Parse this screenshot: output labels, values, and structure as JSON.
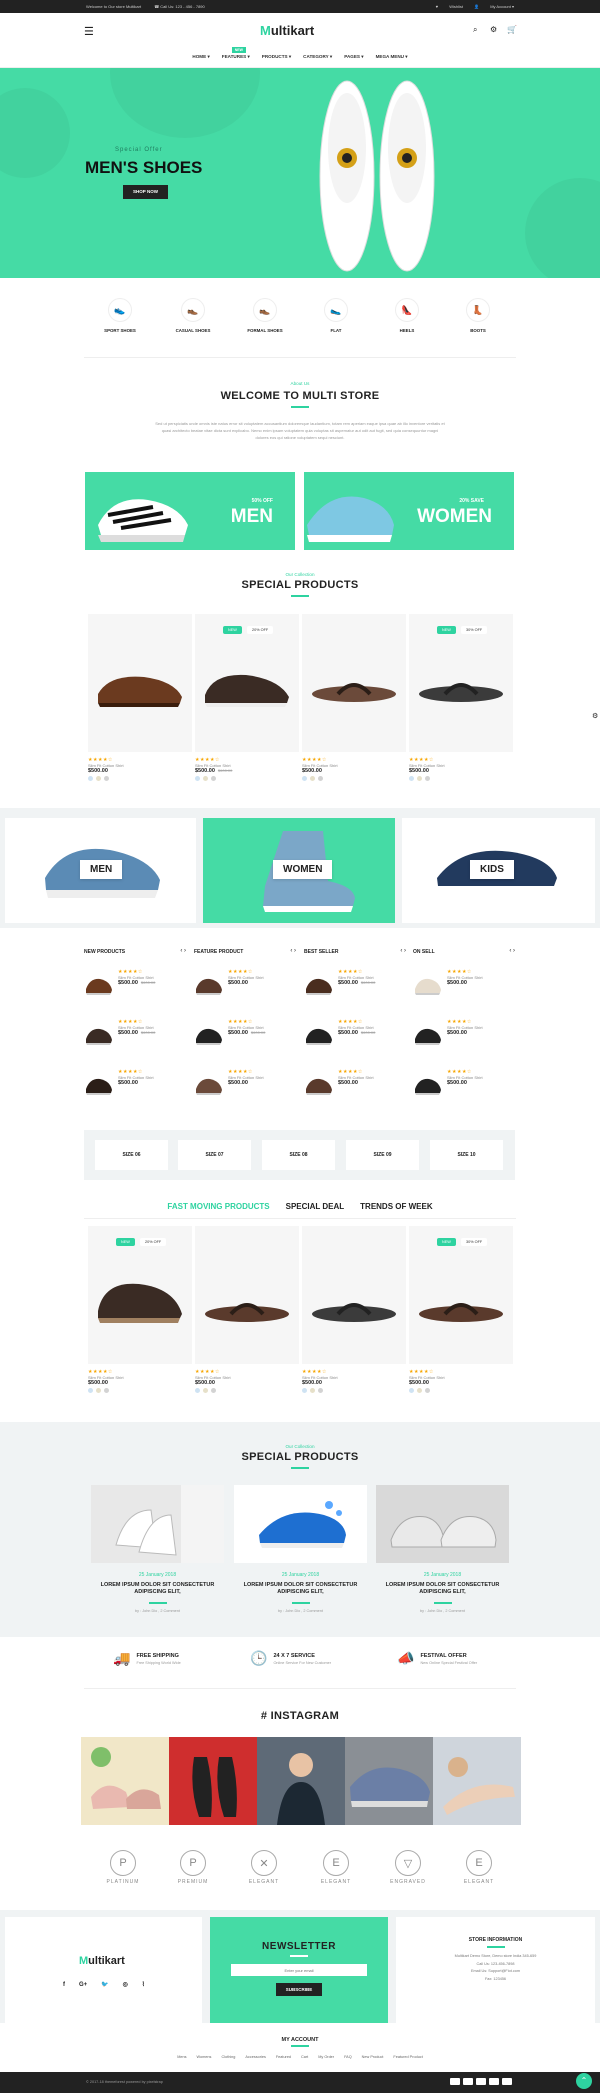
{
  "topbar": {
    "welcome": "Welcome to Our store Multikart",
    "phone": "Call Us: 123 - 456 - 7890",
    "wishlist": "Wishlist",
    "account": "My Account"
  },
  "header": {
    "logo_initial": "M",
    "logo_rest": "ultikart",
    "nav": [
      {
        "label": "HOME"
      },
      {
        "label": "FEATURES",
        "badge": "NEW"
      },
      {
        "label": "PRODUCTS"
      },
      {
        "label": "CATEGORY"
      },
      {
        "label": "PAGES"
      },
      {
        "label": "MEGA MENU"
      }
    ]
  },
  "hero": {
    "kicker": "Special Offer",
    "title": "MEN'S SHOES",
    "button": "SHOP NOW",
    "bg": "#45dba5"
  },
  "categories": [
    "SPORT SHOES",
    "CASUAL SHOES",
    "FORMAL SHOES",
    "FLAT",
    "HEELS",
    "BOOTS"
  ],
  "about": {
    "sub": "About Us",
    "title": "WELCOME TO MULTI STORE",
    "text": "Sed ut perspiciatis unde omnis iste natus error sit voluptatem accusantium doloremque laudantium, totam rem aperiam eaque ipsa quae ab illo inventore veritatis et quasi architecto beatae vitae dicta sunt explicabo. Nemo enim ipsam voluptatem quia voluptas sit aspernatur aut odit aut fugit, sed quia consequuntur magni dolores eos qui ratione voluptatem sequi nesciunt."
  },
  "promo": [
    {
      "off": "50% OFF",
      "label": "MEN"
    },
    {
      "off": "20% SAVE",
      "label": "WOMEN"
    }
  ],
  "special": {
    "sub": "Our Collection",
    "title": "SPECIAL PRODUCTS",
    "products": [
      {
        "name": "Slim Fit Cotton Shirt",
        "price": "$500.00",
        "old": "",
        "new": "",
        "off": ""
      },
      {
        "name": "Slim Fit Cotton Shirt",
        "price": "$500.00",
        "old": "$600.00",
        "new": "NEW",
        "off": "20% OFF"
      },
      {
        "name": "Slim Fit Cotton Shirt",
        "price": "$500.00",
        "old": "",
        "new": "",
        "off": ""
      },
      {
        "name": "Slim Fit Cotton Shirt",
        "price": "$500.00",
        "old": "",
        "new": "NEW",
        "off": "30% OFF"
      }
    ]
  },
  "catbanner": [
    "MEN",
    "WOMEN",
    "KIDS"
  ],
  "lists": [
    {
      "title": "NEW PRODUCTS",
      "items": [
        {
          "name": "Slim Fit Cotton Shirt",
          "price": "$500.00",
          "old": "$600.00"
        },
        {
          "name": "Slim Fit Cotton Shirt",
          "price": "$500.00",
          "old": "$600.00"
        },
        {
          "name": "Slim Fit Cotton Shirt",
          "price": "$500.00",
          "old": ""
        }
      ]
    },
    {
      "title": "FEATURE PRODUCT",
      "items": [
        {
          "name": "Slim Fit Cotton Shirt",
          "price": "$500.00",
          "old": ""
        },
        {
          "name": "Slim Fit Cotton Shirt",
          "price": "$500.00",
          "old": "$600.00"
        },
        {
          "name": "Slim Fit Cotton Shirt",
          "price": "$500.00",
          "old": ""
        }
      ]
    },
    {
      "title": "BEST SELLER",
      "items": [
        {
          "name": "Slim Fit Cotton Shirt",
          "price": "$500.00",
          "old": "$600.00"
        },
        {
          "name": "Slim Fit Cotton Shirt",
          "price": "$500.00",
          "old": "$600.00"
        },
        {
          "name": "Slim Fit Cotton Shirt",
          "price": "$500.00",
          "old": ""
        }
      ]
    },
    {
      "title": "ON SELL",
      "items": [
        {
          "name": "Slim Fit Cotton Shirt",
          "price": "$500.00",
          "old": ""
        },
        {
          "name": "Slim Fit Cotton Shirt",
          "price": "$500.00",
          "old": ""
        },
        {
          "name": "Slim Fit Cotton Shirt",
          "price": "$500.00",
          "old": ""
        }
      ]
    }
  ],
  "sizes": [
    "SIZE 06",
    "SIZE 07",
    "SIZE 08",
    "SIZE 09",
    "SIZE 10"
  ],
  "tabs": [
    "FAST MOVING PRODUCTS",
    "SPECIAL DEAL",
    "TRENDS OF WEEK"
  ],
  "tabproducts": [
    {
      "name": "Slim Fit Cotton Shirt",
      "price": "$500.00",
      "new": "NEW",
      "off": "20% OFF"
    },
    {
      "name": "Slim Fit Cotton Shirt",
      "price": "$500.00",
      "new": "",
      "off": ""
    },
    {
      "name": "Slim Fit Cotton Shirt",
      "price": "$500.00",
      "new": "",
      "off": ""
    },
    {
      "name": "Slim Fit Cotton Shirt",
      "price": "$500.00",
      "new": "NEW",
      "off": "30% OFF"
    }
  ],
  "blog": {
    "sub": "Our Collection",
    "title": "SPECIAL PRODUCTS",
    "posts": [
      {
        "date": "25 January 2018",
        "title": "LOREM IPSUM DOLOR SIT CONSECTETUR ADIPISCING ELIT,",
        "meta": "by : John Dio , 2 Comment"
      },
      {
        "date": "25 January 2018",
        "title": "LOREM IPSUM DOLOR SIT CONSECTETUR ADIPISCING ELIT,",
        "meta": "by : John Dio , 2 Comment"
      },
      {
        "date": "25 January 2018",
        "title": "LOREM IPSUM DOLOR SIT CONSECTETUR ADIPISCING ELIT,",
        "meta": "by : John Dio , 2 Comment"
      }
    ]
  },
  "services": [
    {
      "title": "FREE SHIPPING",
      "sub": "Free Shipping World Wide"
    },
    {
      "title": "24 X 7 SERVICE",
      "sub": "Online Service For New Customer"
    },
    {
      "title": "FESTIVAL OFFER",
      "sub": "New Online Special Festival Offer"
    }
  ],
  "instagram": {
    "title": "# INSTAGRAM"
  },
  "brands": [
    {
      "mark": "P",
      "name": "PLATINUM"
    },
    {
      "mark": "P",
      "name": "PREMIUM"
    },
    {
      "mark": "✕",
      "name": "ELEGANT"
    },
    {
      "mark": "E",
      "name": "ELEGANT"
    },
    {
      "mark": "▽",
      "name": "ENGRAVED"
    },
    {
      "mark": "E",
      "name": "ELEGANT"
    }
  ],
  "footer": {
    "newsletter_title": "NEWSLETTER",
    "email_placeholder": "Enter your email",
    "subscribe": "SUBSCRIBE",
    "store_title": "STORE INFORMATION",
    "store_lines": [
      "Multikart Demo Store, Demo store India 345-659",
      "Call Us: 123-456-7898",
      "Email Us: Support@Fiot.com",
      "Fax: 123456"
    ],
    "account_title": "MY ACCOUNT",
    "account_links": [
      "Mens",
      "Womens",
      "Clothing",
      "Accessories",
      "Featured",
      "Cart",
      "My Order",
      "FAQ",
      "New Product",
      "Featured Product"
    ],
    "copyright": "© 2017-18 themeforest powered by pixelstrap"
  }
}
